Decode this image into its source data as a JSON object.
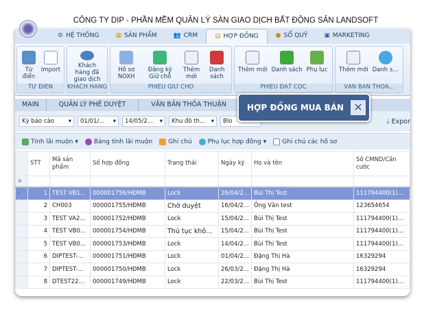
{
  "title": "CÔNG TY DIP - PHẦN MỀM QUẢN LÝ SÀN GIAO DỊCH BẤT ĐỘNG SẢN LANDSOFT",
  "ribbon_tabs": [
    "HỆ THỐNG",
    "SẢN PHẨM",
    "CRM",
    "HỢP ĐỒNG",
    "SỔ QUỸ",
    "MARKETING"
  ],
  "groups": [
    {
      "label": "TỪ ĐIỂN",
      "buttons": [
        "Từ điển",
        "Import"
      ]
    },
    {
      "label": "KHÁCH HÀNG...",
      "buttons": [
        "Khách hàng đã giao dịch"
      ]
    },
    {
      "label": "PHIẾU GIỮ CHỖ",
      "buttons": [
        "Hồ sơ NOXH",
        "Đăng ký Giữ chỗ",
        "Thêm mới",
        "Danh sách"
      ]
    },
    {
      "label": "PHIẾU ĐẶT CỌC",
      "buttons": [
        "Thêm mới",
        "Danh sách",
        "Phụ lục"
      ]
    },
    {
      "label": "VĂN BẢN THỎA...",
      "buttons": [
        "Thêm mới",
        "Danh s..."
      ]
    }
  ],
  "doc_tabs": [
    "MAIN",
    "QUẢN LÝ PHÊ DUYỆT",
    "VĂN BẢN THỎA THUẬN"
  ],
  "filters": [
    "Kỳ báo cáo",
    "01/01/...",
    "14/05/2...",
    "Khu đô th...",
    "Blo"
  ],
  "export_label": "Expor",
  "toolbar": [
    "Tính lãi muộn",
    "Bảng tính lãi muộn",
    "Ghi chú",
    "Phụ lục hợp đồng",
    "Ghi chú các hồ sơ"
  ],
  "columns": [
    "STT",
    "Mã sản phẩm",
    "Số hợp đồng",
    "Trạng thái",
    "Ngày ký",
    "Họ và tên",
    "Số CMND/Căn cước"
  ],
  "rows": [
    [
      "1",
      "TEST VB1...",
      "000001756/HĐMB",
      "Lock",
      "26/04/2...",
      "Bùi Thị Test",
      "111794400(1)..."
    ],
    [
      "2",
      "CH003",
      "000001755/HĐMB",
      "Chờ duyệt",
      "16/04/2...",
      "Ông Văn test",
      "123654654"
    ],
    [
      "3",
      "TEST VA2...",
      "000001752/HĐMB",
      "Lock",
      "15/04/2...",
      "Bùi Thị Test",
      "111794400(1)..."
    ],
    [
      "4",
      "TEST VB0...",
      "000001754/HĐMB",
      "Thủ tục khôn...",
      "15/04/2...",
      "Bùi Thị Test",
      "111794400(1)..."
    ],
    [
      "5",
      "TEST VB0...",
      "000001753/HĐMB",
      "Lock",
      "14/04/2...",
      "Bùi Thị Test",
      "111794400(1)..."
    ],
    [
      "6",
      "DIPTEST-...",
      "000001751/HĐMB",
      "Lock",
      "01/04/2...",
      "Đặng Thị Hà",
      "16329294"
    ],
    [
      "7",
      "DIPTEST-...",
      "000001750/HĐMB",
      "Lock",
      "26/03/2...",
      "Đặng Thị Hà",
      "16329294"
    ],
    [
      "8",
      "DTEST220...",
      "000001749/HĐMB",
      "Lock",
      "22/03/2...",
      "Bùi Thị Test",
      "111794400(1)..."
    ]
  ],
  "popup": {
    "label": "HỢP ĐỒNG MUA BÁN"
  },
  "colors": {
    "accent": "#3f5f8f",
    "selected_row": "#7e96d6"
  }
}
